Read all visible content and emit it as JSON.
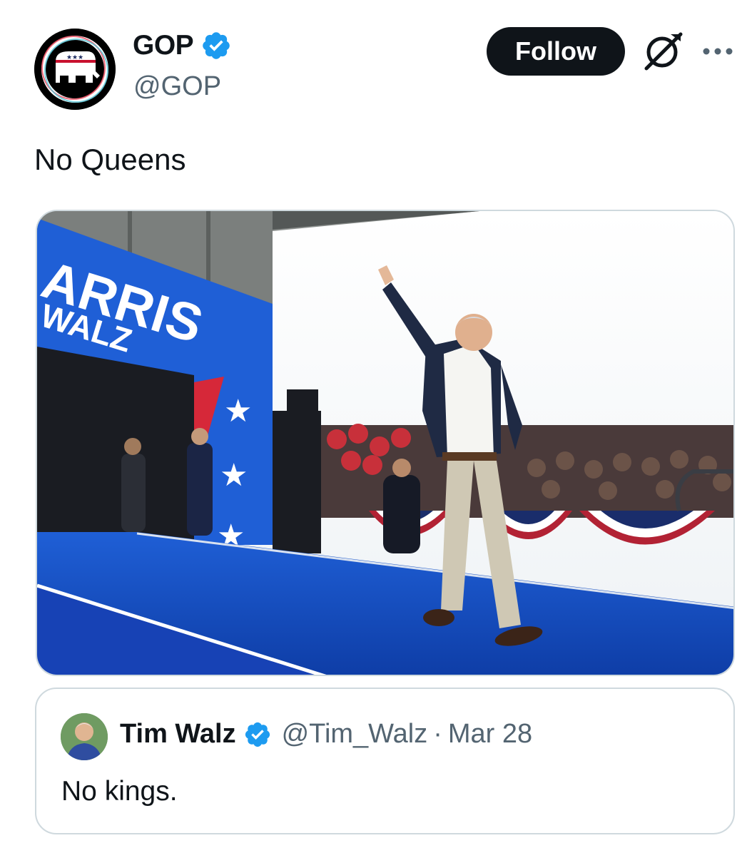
{
  "post": {
    "author": {
      "display_name": "GOP",
      "handle": "@GOP",
      "verified": true,
      "avatar_icon": "gop-elephant-logo-icon"
    },
    "follow_label": "Follow",
    "text": "No Queens",
    "image": {
      "banner_line1": "ARRIS",
      "banner_line2": "WALZ"
    }
  },
  "quoted_post": {
    "author": {
      "display_name": "Tim Walz",
      "handle": "@Tim_Walz",
      "verified": true
    },
    "separator": "·",
    "date": "Mar 28",
    "text": "No kings."
  },
  "colors": {
    "text_primary": "#0f1419",
    "text_secondary": "#536471",
    "verified_blue": "#1d9bf0",
    "border": "#cfd9de",
    "follow_bg": "#0f1419"
  },
  "icons": [
    "verified-badge-icon",
    "grok-icon",
    "more-icon"
  ]
}
